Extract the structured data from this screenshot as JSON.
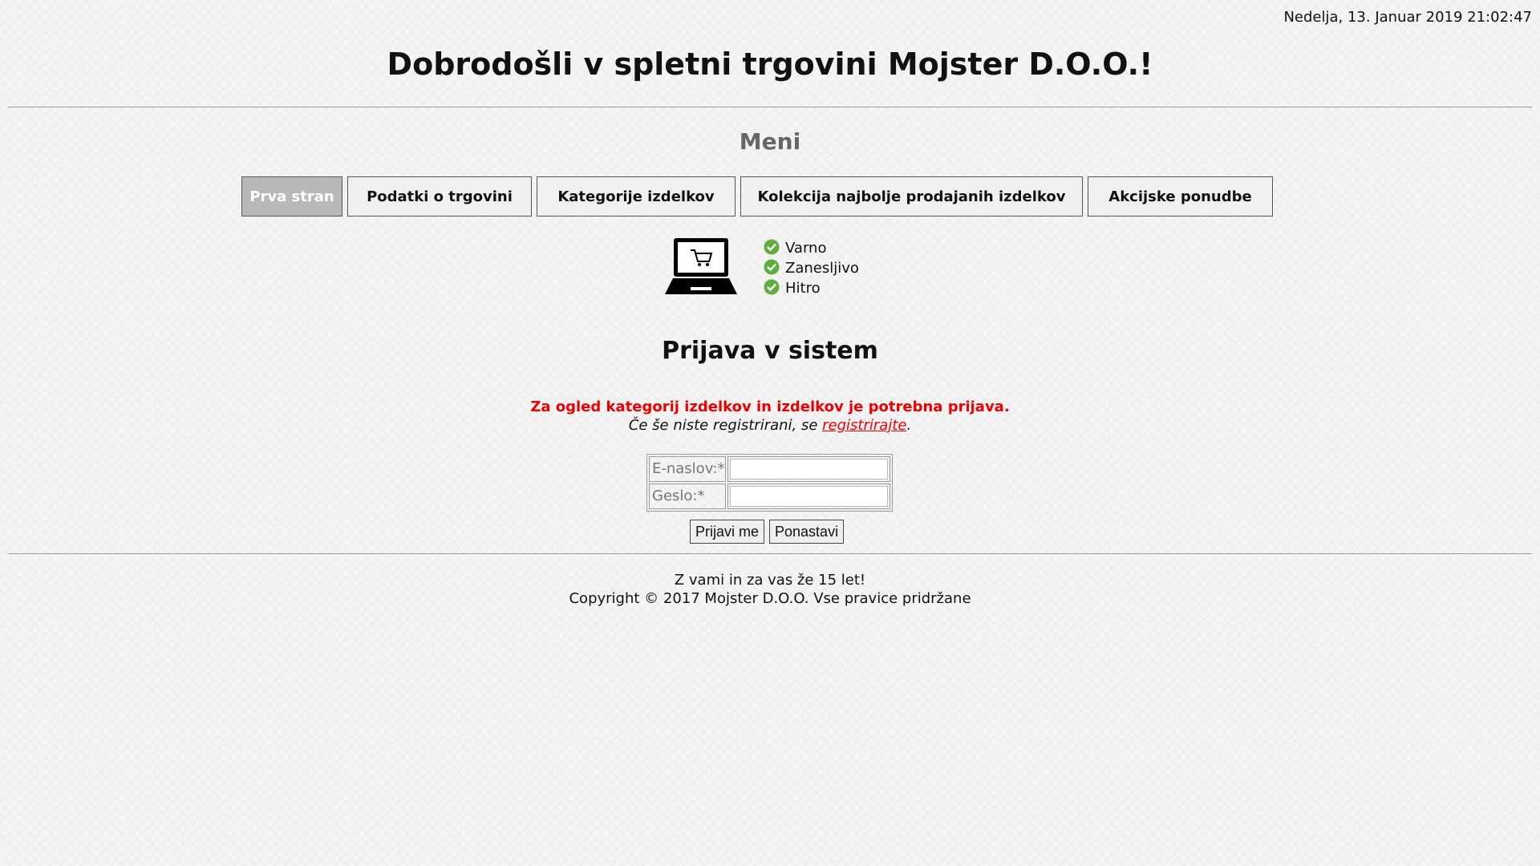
{
  "header": {
    "datetime": "Nedelja, 13. Januar 2019 21:02:47",
    "title": "Dobrodošli v spletni trgovini Mojster D.O.O.!"
  },
  "menu": {
    "title": "Meni",
    "items": [
      {
        "label": "Prva stran",
        "active": true
      },
      {
        "label": "Podatki o trgovini",
        "active": false
      },
      {
        "label": "Kategorije izdelkov",
        "active": false
      },
      {
        "label": "Kolekcija najbolje prodajanih izdelkov",
        "active": false
      },
      {
        "label": "Akcijske ponudbe",
        "active": false
      }
    ]
  },
  "features": {
    "icon": "laptop-cart-icon",
    "check_icon": "green-check-icon",
    "items": [
      "Varno",
      "Zanesljivo",
      "Hitro"
    ]
  },
  "login": {
    "title": "Prijava v sistem",
    "notice": "Za ogled kategorij izdelkov in izdelkov je potrebna prijava.",
    "register_prefix": "Če še niste registrirani, se ",
    "register_link": "registrirajte",
    "register_suffix": ".",
    "email_label": "E-naslov:*",
    "email_value": "",
    "password_label": "Geslo:*",
    "password_value": "",
    "submit_label": "Prijavi me",
    "reset_label": "Ponastavi"
  },
  "footer": {
    "tagline": "Z vami in za vas že 15 let!",
    "copyright": "Copyright © 2017 Mojster D.O.O. Vse pravice pridržane"
  },
  "colors": {
    "notice_red": "#ee0000",
    "active_menu_bg": "#b9b9b9",
    "check_green": "#5fae3c"
  }
}
